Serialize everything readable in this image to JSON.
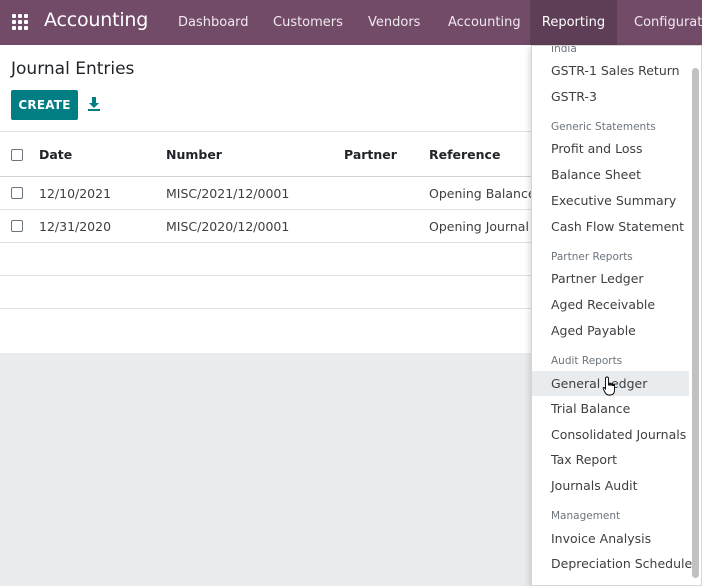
{
  "navbar": {
    "app_title": "Accounting",
    "menu": [
      "Dashboard",
      "Customers",
      "Vendors",
      "Accounting",
      "Reporting",
      "Configuration"
    ]
  },
  "page": {
    "title": "Journal Entries",
    "create_label": "CREATE"
  },
  "table": {
    "columns": [
      "Date",
      "Number",
      "Partner",
      "Reference"
    ],
    "rows": [
      {
        "date": "12/10/2021",
        "number": "MISC/2021/12/0001",
        "partner": "",
        "reference": "Opening Balance"
      },
      {
        "date": "12/31/2020",
        "number": "MISC/2020/12/0001",
        "partner": "",
        "reference": "Opening Journal Entry"
      }
    ]
  },
  "reporting_menu": {
    "sections": [
      {
        "header": "India",
        "items": [
          "GSTR-1 Sales Return",
          "GSTR-3"
        ]
      },
      {
        "header": "Generic Statements",
        "items": [
          "Profit and Loss",
          "Balance Sheet",
          "Executive Summary",
          "Cash Flow Statement"
        ]
      },
      {
        "header": "Partner Reports",
        "items": [
          "Partner Ledger",
          "Aged Receivable",
          "Aged Payable"
        ]
      },
      {
        "header": "Audit Reports",
        "items": [
          "General Ledger",
          "Trial Balance",
          "Consolidated Journals",
          "Tax Report",
          "Journals Audit"
        ]
      },
      {
        "header": "Management",
        "items": [
          "Invoice Analysis",
          "Depreciation Schedule"
        ]
      }
    ]
  },
  "colors": {
    "navbar": "#714b67",
    "navbar_active": "#5e3e56",
    "primary_button": "#017e84"
  }
}
